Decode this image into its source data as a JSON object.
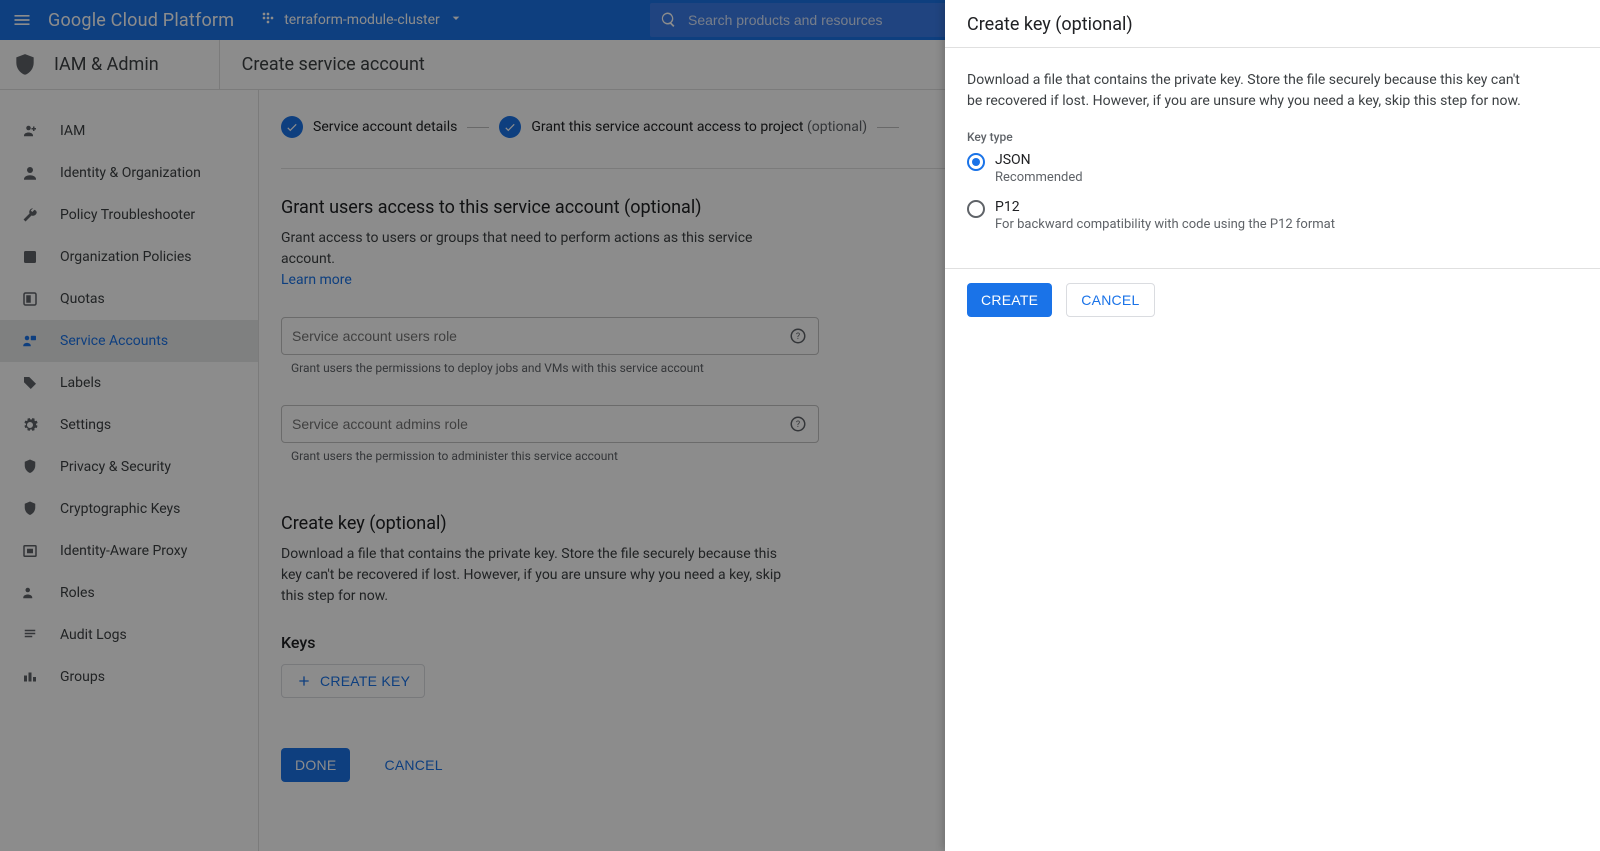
{
  "topbar": {
    "logo": "Google Cloud Platform",
    "project_name": "terraform-module-cluster",
    "search_placeholder": "Search products and resources"
  },
  "subheader": {
    "section_title": "IAM & Admin",
    "page_title": "Create service account"
  },
  "sidenav": {
    "items": [
      {
        "label": "IAM"
      },
      {
        "label": "Identity & Organization"
      },
      {
        "label": "Policy Troubleshooter"
      },
      {
        "label": "Organization Policies"
      },
      {
        "label": "Quotas"
      },
      {
        "label": "Service Accounts",
        "active": true
      },
      {
        "label": "Labels"
      },
      {
        "label": "Settings"
      },
      {
        "label": "Privacy & Security"
      },
      {
        "label": "Cryptographic Keys"
      },
      {
        "label": "Identity-Aware Proxy"
      },
      {
        "label": "Roles"
      },
      {
        "label": "Audit Logs"
      },
      {
        "label": "Groups"
      }
    ]
  },
  "stepper": {
    "step1_label": "Service account details",
    "step2_label": "Grant this service account access to project ",
    "step2_optional": "(optional)"
  },
  "grant_section": {
    "title": "Grant users access to this service account (optional)",
    "description": "Grant access to users or groups that need to perform actions as this service account.",
    "learn_more": "Learn more",
    "users_role_placeholder": "Service account users role",
    "users_role_helper": "Grant users the permissions to deploy jobs and VMs with this service account",
    "admins_role_placeholder": "Service account admins role",
    "admins_role_helper": "Grant users the permission to administer this service account"
  },
  "create_key_section": {
    "title": "Create key (optional)",
    "description": "Download a file that contains the private key. Store the file securely because this key can't be recovered if lost. However, if you are unsure why you need a key, skip this step for now.",
    "keys_heading": "Keys",
    "create_key_btn": "CREATE KEY"
  },
  "footer": {
    "done": "DONE",
    "cancel": "CANCEL"
  },
  "panel": {
    "title": "Create key (optional)",
    "description": "Download a file that contains the private key. Store the file securely because this key can't be recovered if lost. However, if you are unsure why you need a key, skip this step for now.",
    "key_type_label": "Key type",
    "json": {
      "title": "JSON",
      "desc": "Recommended"
    },
    "p12": {
      "title": "P12",
      "desc": "For backward compatibility with code using the P12 format"
    },
    "create": "CREATE",
    "cancel": "CANCEL"
  }
}
